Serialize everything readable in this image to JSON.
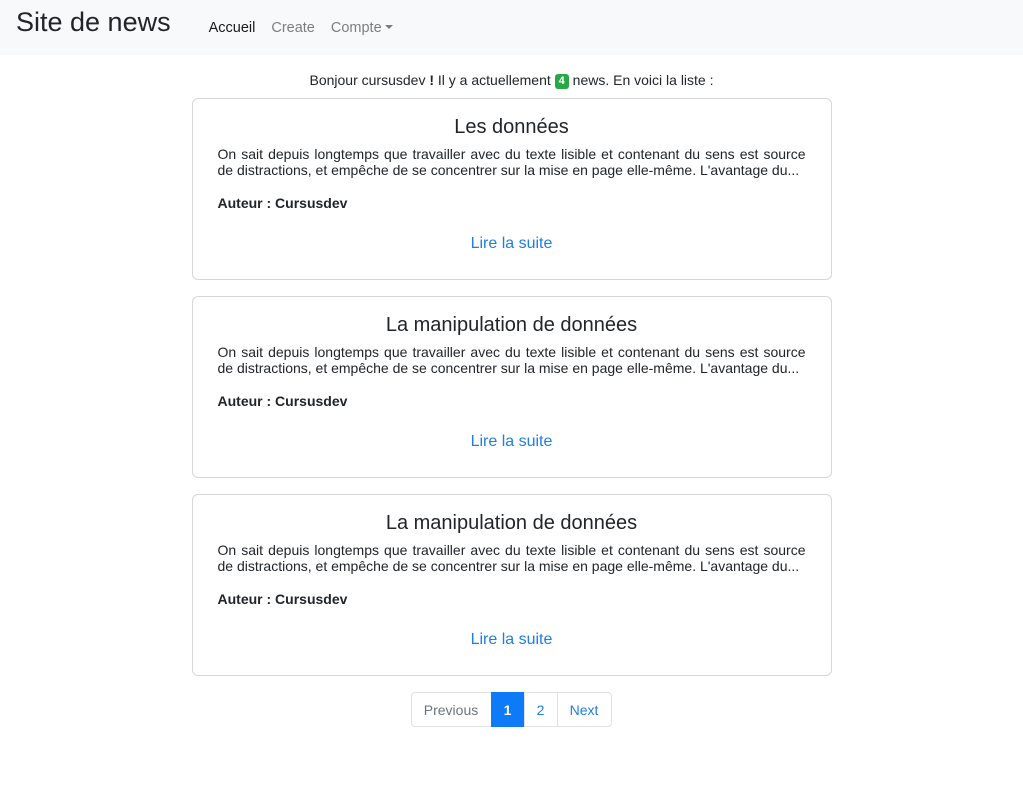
{
  "navbar": {
    "brand": "Site de news",
    "links": [
      {
        "label": "Accueil"
      },
      {
        "label": "Create"
      },
      {
        "label": "Compte"
      }
    ]
  },
  "greeting": {
    "prefix": "Bonjour cursusdev",
    "exclaim": "!",
    "middle": "Il y a actuellement",
    "count": "4",
    "suffix": "news. En voici la liste :"
  },
  "articles": [
    {
      "title": "Les données",
      "excerpt": "On sait depuis longtemps que travailler avec du texte lisible et contenant du sens est source de distractions, et empêche de se concentrer sur la mise en page elle-même. L'avantage du...",
      "author": "Auteur : Cursusdev",
      "link": "Lire la suite"
    },
    {
      "title": "La manipulation de données",
      "excerpt": "On sait depuis longtemps que travailler avec du texte lisible et contenant du sens est source de distractions, et empêche de se concentrer sur la mise en page elle-même. L'avantage du...",
      "author": "Auteur : Cursusdev",
      "link": "Lire la suite"
    },
    {
      "title": "La manipulation de données",
      "excerpt": "On sait depuis longtemps que travailler avec du texte lisible et contenant du sens est source de distractions, et empêche de se concentrer sur la mise en page elle-même. L'avantage du...",
      "author": "Auteur : Cursusdev",
      "link": "Lire la suite"
    }
  ],
  "pagination": {
    "previous": "Previous",
    "pages": [
      "1",
      "2"
    ],
    "current": "1",
    "next": "Next"
  },
  "colors": {
    "badge": "#28a745",
    "link": "#1e7ee6",
    "active_page": "#0d7bf7"
  }
}
